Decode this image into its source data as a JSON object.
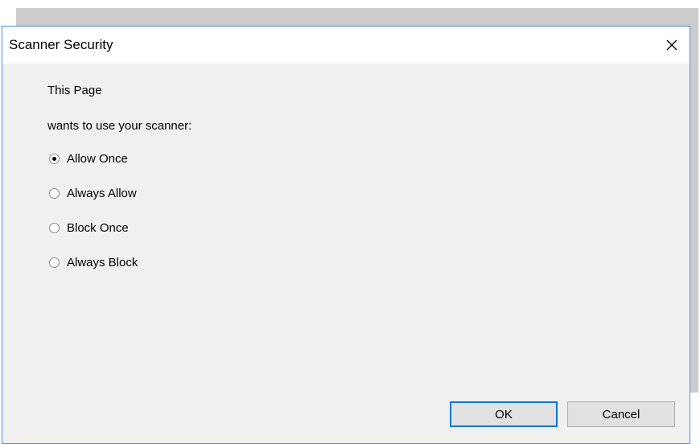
{
  "dialog": {
    "title": "Scanner Security",
    "close_icon": "close-icon",
    "message_line1": "This Page",
    "message_line2": "wants to use your scanner:",
    "options": [
      {
        "label": "Allow Once",
        "selected": true
      },
      {
        "label": "Always Allow",
        "selected": false
      },
      {
        "label": "Block Once",
        "selected": false
      },
      {
        "label": "Always Block",
        "selected": false
      }
    ],
    "ok_label": "OK",
    "cancel_label": "Cancel"
  },
  "colors": {
    "accent": "#0078d7",
    "dialog_bg": "#f0f0f0",
    "border": "#4a90d9"
  }
}
